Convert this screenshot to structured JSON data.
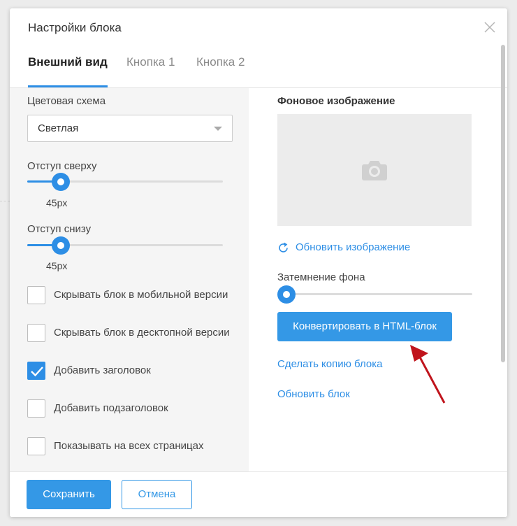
{
  "modal": {
    "title": "Настройки блока"
  },
  "tabs": [
    {
      "label": "Внешний вид",
      "active": true
    },
    {
      "label": "Кнопка 1",
      "active": false
    },
    {
      "label": "Кнопка 2",
      "active": false
    }
  ],
  "left": {
    "color_scheme_label": "Цветовая схема",
    "color_scheme_value": "Светлая",
    "top_padding_label": "Отступ сверху",
    "top_padding_value": "45px",
    "top_padding_fraction": 0.17,
    "bottom_padding_label": "Отступ снизу",
    "bottom_padding_value": "45px",
    "bottom_padding_fraction": 0.17,
    "checkboxes": [
      {
        "label": "Скрывать блок в мобильной версии",
        "checked": false
      },
      {
        "label": "Скрывать блок в десктопной версии",
        "checked": false
      },
      {
        "label": "Добавить заголовок",
        "checked": true
      },
      {
        "label": "Добавить подзаголовок",
        "checked": false
      },
      {
        "label": "Показывать на всех страницах",
        "checked": false
      }
    ]
  },
  "right": {
    "bg_image_title": "Фоновое изображение",
    "refresh_image_label": "Обновить изображение",
    "dimming_label": "Затемнение фона",
    "dimming_fraction": 0.0,
    "convert_button_label": "Конвертировать в HTML-блок",
    "copy_block_label": "Сделать копию блока",
    "refresh_block_label": "Обновить блок"
  },
  "footer": {
    "save_label": "Сохранить",
    "cancel_label": "Отмена"
  },
  "icons": {
    "close": "close-icon",
    "camera": "camera-icon",
    "refresh": "refresh-icon",
    "check": "check-icon",
    "dropdown": "chevron-down-icon"
  },
  "colors": {
    "accent": "#2d8ee5",
    "button": "#3498e6",
    "annotation_arrow": "#c0141c"
  }
}
